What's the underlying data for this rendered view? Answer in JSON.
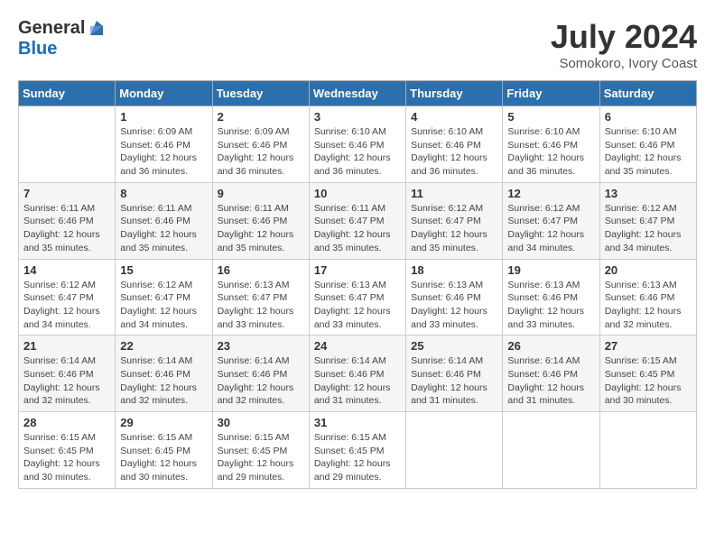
{
  "logo": {
    "general": "General",
    "blue": "Blue"
  },
  "title": "July 2024",
  "location": "Somokoro, Ivory Coast",
  "days_of_week": [
    "Sunday",
    "Monday",
    "Tuesday",
    "Wednesday",
    "Thursday",
    "Friday",
    "Saturday"
  ],
  "weeks": [
    [
      {
        "day": "",
        "sunrise": "",
        "sunset": "",
        "daylight": ""
      },
      {
        "day": "1",
        "sunrise": "Sunrise: 6:09 AM",
        "sunset": "Sunset: 6:46 PM",
        "daylight": "Daylight: 12 hours and 36 minutes."
      },
      {
        "day": "2",
        "sunrise": "Sunrise: 6:09 AM",
        "sunset": "Sunset: 6:46 PM",
        "daylight": "Daylight: 12 hours and 36 minutes."
      },
      {
        "day": "3",
        "sunrise": "Sunrise: 6:10 AM",
        "sunset": "Sunset: 6:46 PM",
        "daylight": "Daylight: 12 hours and 36 minutes."
      },
      {
        "day": "4",
        "sunrise": "Sunrise: 6:10 AM",
        "sunset": "Sunset: 6:46 PM",
        "daylight": "Daylight: 12 hours and 36 minutes."
      },
      {
        "day": "5",
        "sunrise": "Sunrise: 6:10 AM",
        "sunset": "Sunset: 6:46 PM",
        "daylight": "Daylight: 12 hours and 36 minutes."
      },
      {
        "day": "6",
        "sunrise": "Sunrise: 6:10 AM",
        "sunset": "Sunset: 6:46 PM",
        "daylight": "Daylight: 12 hours and 35 minutes."
      }
    ],
    [
      {
        "day": "7",
        "sunrise": "Sunrise: 6:11 AM",
        "sunset": "Sunset: 6:46 PM",
        "daylight": "Daylight: 12 hours and 35 minutes."
      },
      {
        "day": "8",
        "sunrise": "Sunrise: 6:11 AM",
        "sunset": "Sunset: 6:46 PM",
        "daylight": "Daylight: 12 hours and 35 minutes."
      },
      {
        "day": "9",
        "sunrise": "Sunrise: 6:11 AM",
        "sunset": "Sunset: 6:46 PM",
        "daylight": "Daylight: 12 hours and 35 minutes."
      },
      {
        "day": "10",
        "sunrise": "Sunrise: 6:11 AM",
        "sunset": "Sunset: 6:47 PM",
        "daylight": "Daylight: 12 hours and 35 minutes."
      },
      {
        "day": "11",
        "sunrise": "Sunrise: 6:12 AM",
        "sunset": "Sunset: 6:47 PM",
        "daylight": "Daylight: 12 hours and 35 minutes."
      },
      {
        "day": "12",
        "sunrise": "Sunrise: 6:12 AM",
        "sunset": "Sunset: 6:47 PM",
        "daylight": "Daylight: 12 hours and 34 minutes."
      },
      {
        "day": "13",
        "sunrise": "Sunrise: 6:12 AM",
        "sunset": "Sunset: 6:47 PM",
        "daylight": "Daylight: 12 hours and 34 minutes."
      }
    ],
    [
      {
        "day": "14",
        "sunrise": "Sunrise: 6:12 AM",
        "sunset": "Sunset: 6:47 PM",
        "daylight": "Daylight: 12 hours and 34 minutes."
      },
      {
        "day": "15",
        "sunrise": "Sunrise: 6:12 AM",
        "sunset": "Sunset: 6:47 PM",
        "daylight": "Daylight: 12 hours and 34 minutes."
      },
      {
        "day": "16",
        "sunrise": "Sunrise: 6:13 AM",
        "sunset": "Sunset: 6:47 PM",
        "daylight": "Daylight: 12 hours and 33 minutes."
      },
      {
        "day": "17",
        "sunrise": "Sunrise: 6:13 AM",
        "sunset": "Sunset: 6:47 PM",
        "daylight": "Daylight: 12 hours and 33 minutes."
      },
      {
        "day": "18",
        "sunrise": "Sunrise: 6:13 AM",
        "sunset": "Sunset: 6:46 PM",
        "daylight": "Daylight: 12 hours and 33 minutes."
      },
      {
        "day": "19",
        "sunrise": "Sunrise: 6:13 AM",
        "sunset": "Sunset: 6:46 PM",
        "daylight": "Daylight: 12 hours and 33 minutes."
      },
      {
        "day": "20",
        "sunrise": "Sunrise: 6:13 AM",
        "sunset": "Sunset: 6:46 PM",
        "daylight": "Daylight: 12 hours and 32 minutes."
      }
    ],
    [
      {
        "day": "21",
        "sunrise": "Sunrise: 6:14 AM",
        "sunset": "Sunset: 6:46 PM",
        "daylight": "Daylight: 12 hours and 32 minutes."
      },
      {
        "day": "22",
        "sunrise": "Sunrise: 6:14 AM",
        "sunset": "Sunset: 6:46 PM",
        "daylight": "Daylight: 12 hours and 32 minutes."
      },
      {
        "day": "23",
        "sunrise": "Sunrise: 6:14 AM",
        "sunset": "Sunset: 6:46 PM",
        "daylight": "Daylight: 12 hours and 32 minutes."
      },
      {
        "day": "24",
        "sunrise": "Sunrise: 6:14 AM",
        "sunset": "Sunset: 6:46 PM",
        "daylight": "Daylight: 12 hours and 31 minutes."
      },
      {
        "day": "25",
        "sunrise": "Sunrise: 6:14 AM",
        "sunset": "Sunset: 6:46 PM",
        "daylight": "Daylight: 12 hours and 31 minutes."
      },
      {
        "day": "26",
        "sunrise": "Sunrise: 6:14 AM",
        "sunset": "Sunset: 6:46 PM",
        "daylight": "Daylight: 12 hours and 31 minutes."
      },
      {
        "day": "27",
        "sunrise": "Sunrise: 6:15 AM",
        "sunset": "Sunset: 6:45 PM",
        "daylight": "Daylight: 12 hours and 30 minutes."
      }
    ],
    [
      {
        "day": "28",
        "sunrise": "Sunrise: 6:15 AM",
        "sunset": "Sunset: 6:45 PM",
        "daylight": "Daylight: 12 hours and 30 minutes."
      },
      {
        "day": "29",
        "sunrise": "Sunrise: 6:15 AM",
        "sunset": "Sunset: 6:45 PM",
        "daylight": "Daylight: 12 hours and 30 minutes."
      },
      {
        "day": "30",
        "sunrise": "Sunrise: 6:15 AM",
        "sunset": "Sunset: 6:45 PM",
        "daylight": "Daylight: 12 hours and 29 minutes."
      },
      {
        "day": "31",
        "sunrise": "Sunrise: 6:15 AM",
        "sunset": "Sunset: 6:45 PM",
        "daylight": "Daylight: 12 hours and 29 minutes."
      },
      {
        "day": "",
        "sunrise": "",
        "sunset": "",
        "daylight": ""
      },
      {
        "day": "",
        "sunrise": "",
        "sunset": "",
        "daylight": ""
      },
      {
        "day": "",
        "sunrise": "",
        "sunset": "",
        "daylight": ""
      }
    ]
  ]
}
